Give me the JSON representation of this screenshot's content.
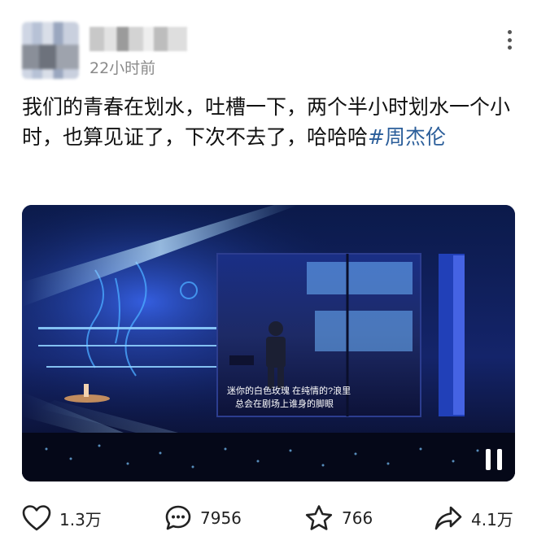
{
  "post": {
    "timestamp": "22小时前",
    "text": "我们的青春在划水，吐槽一下，两个半小时划水一个小时，也算见证了，下次不去了，哈哈哈",
    "hashtag": "#周杰伦"
  },
  "video": {
    "subtitle_line1": "迷你的白色玫瑰 在纯情的?浪里",
    "subtitle_line2": "总会在剧场上谁身的脚眼"
  },
  "actions": {
    "likes": "1.3万",
    "comments": "7956",
    "favorites": "766",
    "shares": "4.1万"
  },
  "icons": [
    "more-icon",
    "pause-icon",
    "heart-icon",
    "comment-icon",
    "star-icon",
    "share-icon"
  ]
}
